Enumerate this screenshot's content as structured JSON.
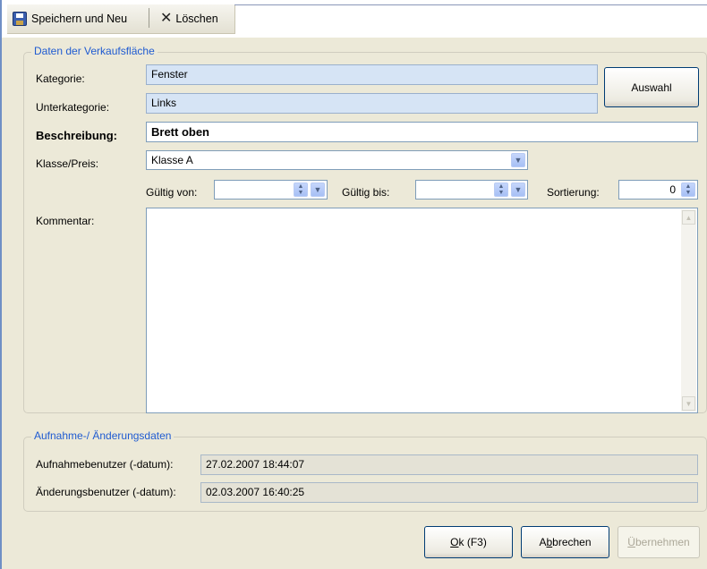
{
  "toolbar": {
    "save_new_label": "Speichern und Neu",
    "delete_label": "Löschen"
  },
  "sales_area": {
    "group_title": "Daten der Verkaufsfläche",
    "category_label": "Kategorie:",
    "category_value": "Fenster",
    "subcategory_label": "Unterkategorie:",
    "subcategory_value": "Links",
    "select_button": "Auswahl",
    "description_label": "Beschreibung:",
    "description_value": "Brett oben",
    "class_price_label": "Klasse/Preis:",
    "class_price_value": "Klasse A",
    "valid_from_label": "Gültig von:",
    "valid_from_value": "  .   .",
    "valid_to_label": "Gültig bis:",
    "valid_to_value": "  .   .",
    "sort_label": "Sortierung:",
    "sort_value": "0",
    "comment_label": "Kommentar:",
    "comment_value": ""
  },
  "audit": {
    "group_title": "Aufnahme-/ Änderungsdaten",
    "created_label": "Aufnahmebenutzer (-datum):",
    "created_value": "27.02.2007 18:44:07",
    "changed_label": "Änderungsbenutzer (-datum):",
    "changed_value": "02.03.2007 16:40:25"
  },
  "footer": {
    "ok_mnemonic": "O",
    "ok_rest": "k (F3)",
    "cancel_pre": "A",
    "cancel_mnemonic": "b",
    "cancel_rest": "brechen",
    "apply_mnemonic": "Ü",
    "apply_rest": "bernehmen"
  }
}
